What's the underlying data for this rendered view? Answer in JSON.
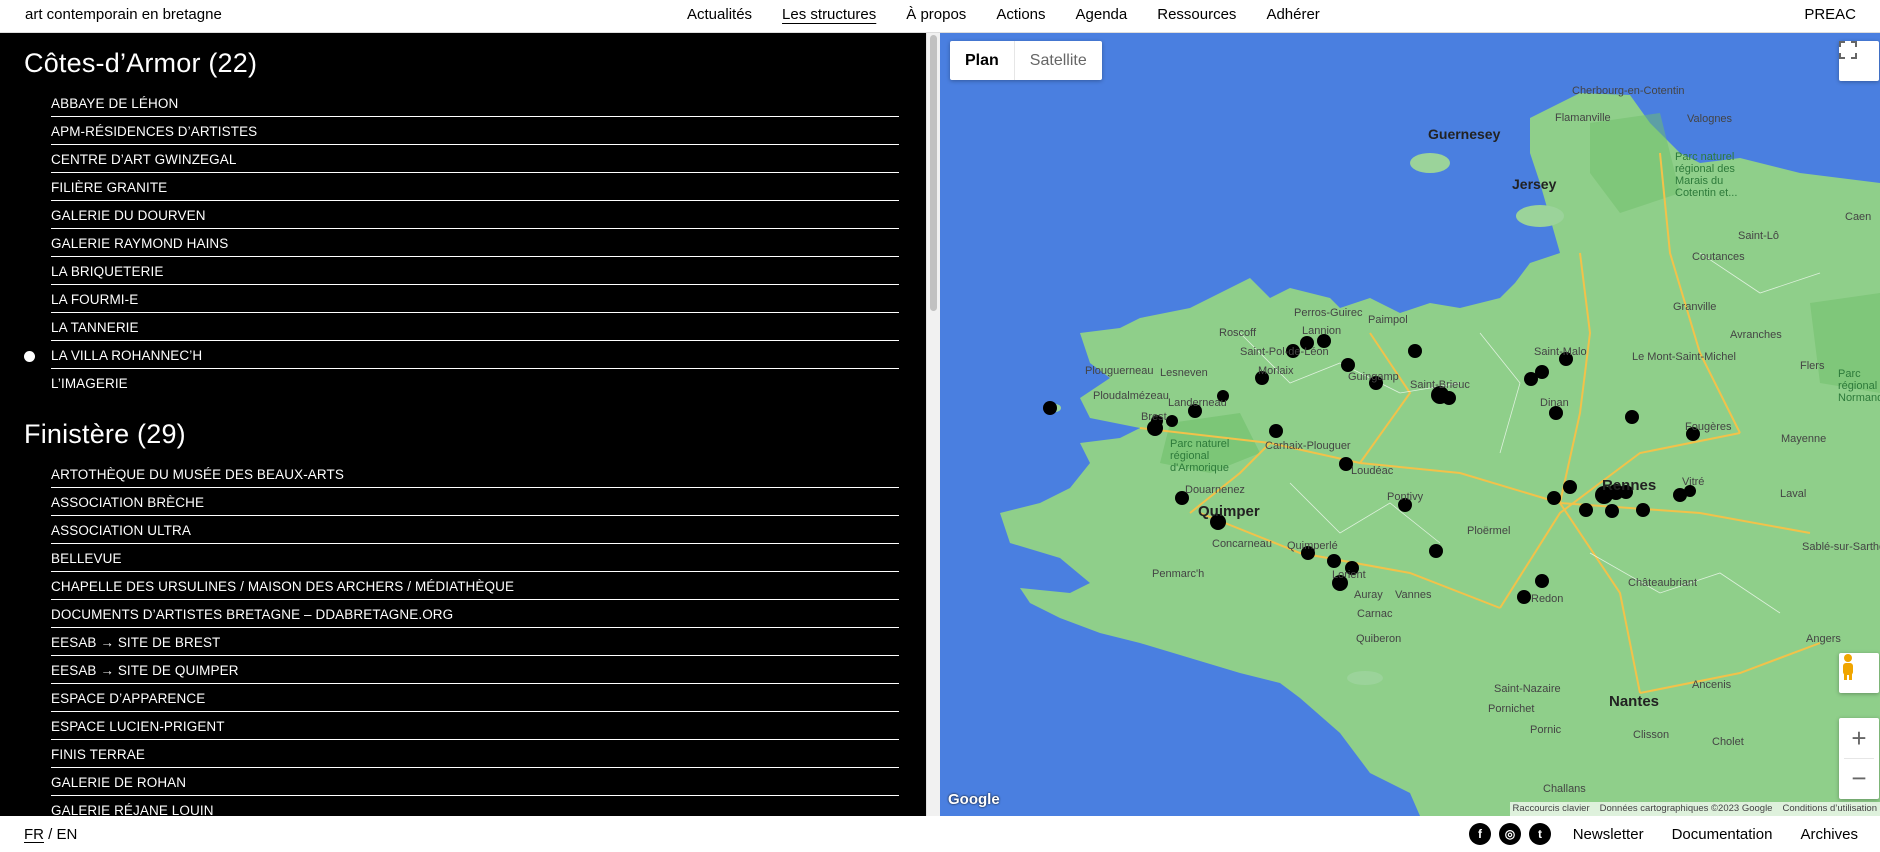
{
  "header": {
    "site_title": "art contemporain en bretagne",
    "nav": [
      "Actualités",
      "Les structures",
      "À propos",
      "Actions",
      "Agenda",
      "Ressources",
      "Adhérer"
    ],
    "active_nav": "Les structures",
    "right_link": "PREAC"
  },
  "regions": [
    {
      "title": "Côtes-d’Armor (22)",
      "items": [
        "Abbaye de Léhon",
        "APM-Résidences d’artistes",
        "Centre d’art Gwinzegal",
        "Filière granite",
        "Galerie du Dourven",
        "Galerie Raymond Hains",
        "La Briqueterie",
        "La Fourmi-e",
        "La Tannerie",
        "La Villa Rohannec’h",
        "L’Imagerie"
      ],
      "selected_index": 9
    },
    {
      "title": "Finistère (29)",
      "items": [
        "Artothèque du musée des beaux-arts",
        "Association Brèche",
        "Association Ultra",
        "Bellevue",
        "Chapelle des Ursulines / Maison des archers / Médiathèque",
        "Documents d’artistes Bretagne – ddabretagne.org",
        "EESAB → site de Brest",
        "EESAB → site de Quimper",
        "Espace d’apparence",
        "Espace Lucien-Prigent",
        "Finis Terrae",
        "Galerie de Rohan",
        "Galerie Réjane Louin"
      ]
    }
  ],
  "map": {
    "toggle": {
      "plan": "Plan",
      "satellite": "Satellite"
    },
    "google": "Google",
    "attribution": [
      "Raccourcis clavier",
      "Données cartographiques ©2023 Google",
      "Conditions d’utilisation"
    ],
    "labels": {
      "guernesey": "Guernesey",
      "jersey": "Jersey",
      "cherbourg": "Cherbourg-en-Cotentin",
      "valognes": "Valognes",
      "flamanville": "Flamanville",
      "caen": "Caen",
      "coutances": "Coutances",
      "saint_lo": "Saint-Lô",
      "granville": "Granville",
      "avranches": "Avranches",
      "mont_saint_michel": "Le Mont-Saint-Michel",
      "saint_malo": "Saint-Malo",
      "dinan": "Dinan",
      "saint_brieuc": "Saint-Brieuc",
      "paimpol": "Paimpol",
      "perros": "Perros-Guirec",
      "lannion": "Lannion",
      "roscoff": "Roscoff",
      "morlaix": "Morlaix",
      "saint_pol": "Saint-Pol-de-Léon",
      "plouguerneau": "Plouguerneau",
      "lesneven": "Lesneven",
      "ploudalmezeau": "Ploudalmézeau",
      "landerneau": "Landerneau",
      "brest": "Brest",
      "guingamp": "Guingamp",
      "carhaix": "Carhaix-Plouguer",
      "loudeac": "Loudéac",
      "douarnenez": "Douarnenez",
      "quimper": "Quimper",
      "concarneau": "Concarneau",
      "quimperle": "Quimperlé",
      "penmarch": "Penmarc'h",
      "pontivy": "Pontivy",
      "ploermel": "Ploërmel",
      "lorient": "Lorient",
      "auray": "Auray",
      "vannes": "Vannes",
      "carnac": "Carnac",
      "quiberon": "Quiberon",
      "redon": "Redon",
      "rennes": "Rennes",
      "vitre": "Vitré",
      "fougeres": "Fougères",
      "mayenne": "Mayenne",
      "laval": "Laval",
      "chateaubriant": "Châteaubriant",
      "angers": "Angers",
      "nantes": "Nantes",
      "saint_nazaire": "Saint-Nazaire",
      "pornichet": "Pornichet",
      "pornic": "Pornic",
      "clisson": "Clisson",
      "cholet": "Cholet",
      "challans": "Challans",
      "sable": "Sablé-sur-Sarthe",
      "ancenis": "Ancenis",
      "flers": "Flers",
      "park_armorique": "Parc naturel\nrégional\nd'Armorique",
      "park_normandie": "Parc naturel\nrégional des\nMarais du\nCotentin et...",
      "park_normandie_maine": "Parc\nrégional\nNormandie..."
    }
  },
  "footer": {
    "lang_fr": "FR",
    "lang_sep": "/",
    "lang_en": "EN",
    "social": {
      "facebook": "f",
      "instagram": "◎",
      "twitter": "t"
    },
    "links": [
      "Newsletter",
      "Documentation",
      "Archives"
    ]
  }
}
